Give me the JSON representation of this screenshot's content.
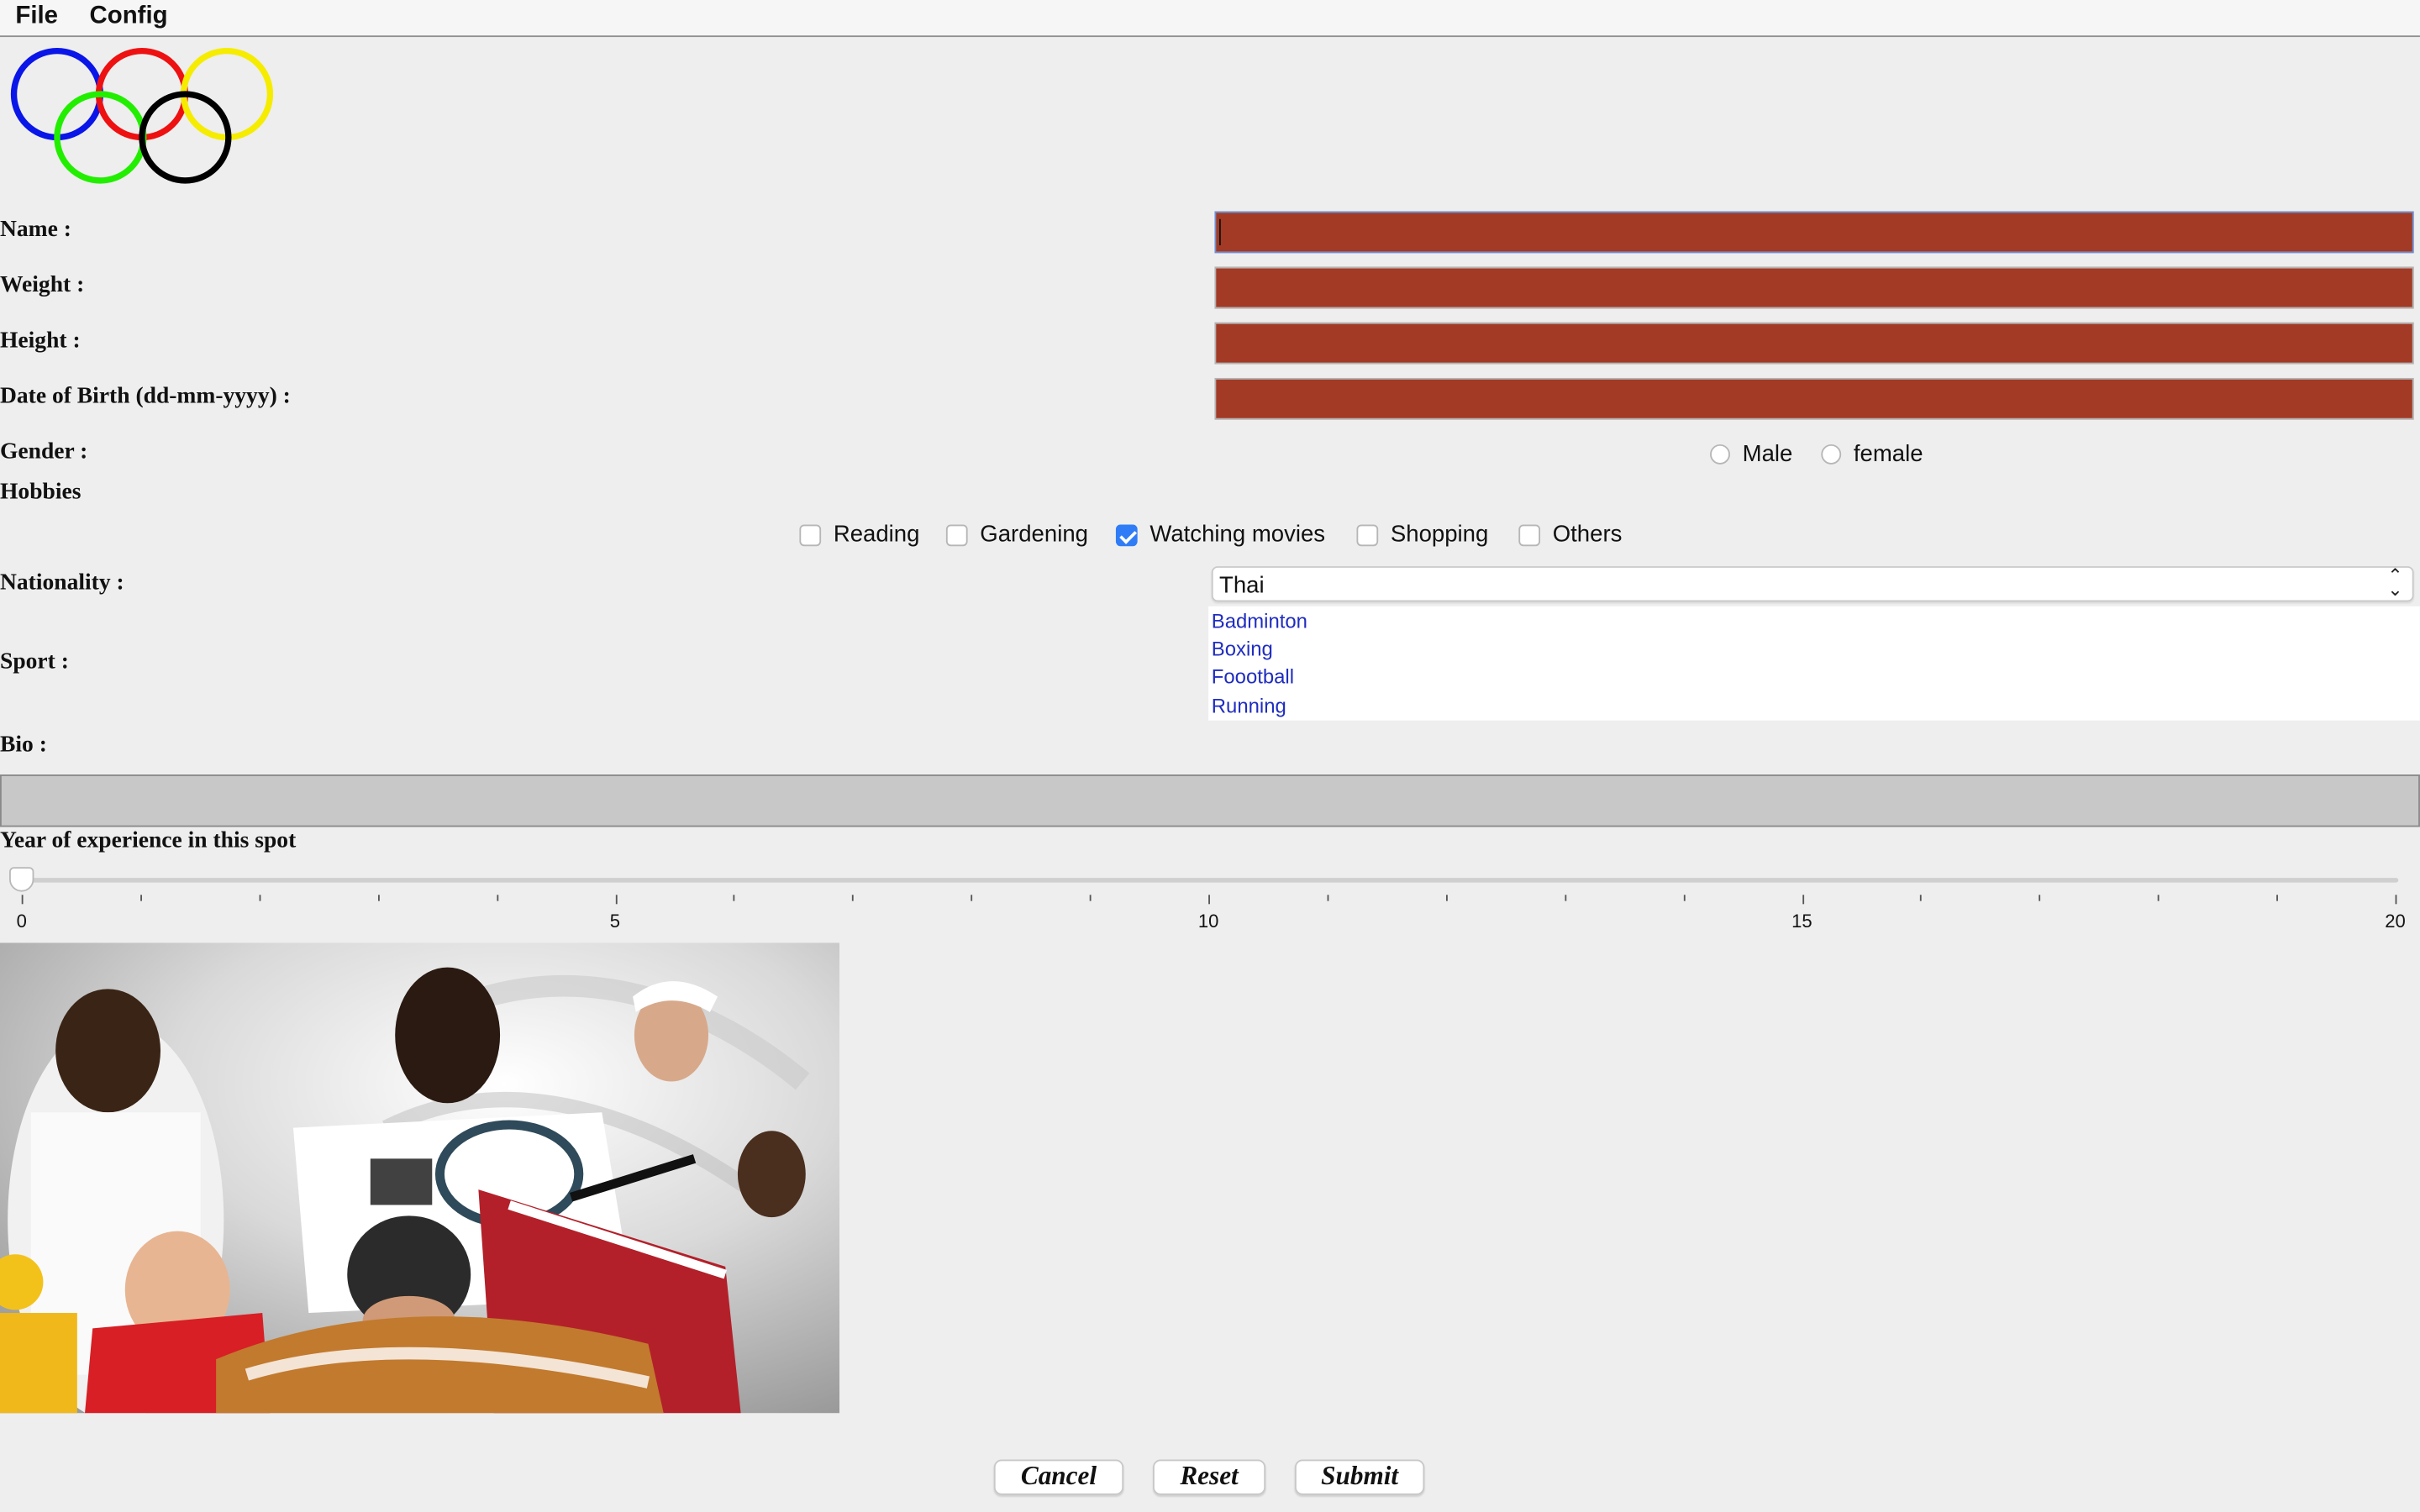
{
  "menu": {
    "file": "File",
    "config": "Config"
  },
  "logo": {
    "ring_colors": [
      "#0a15e8",
      "#ee1111",
      "#f5ec00",
      "#22ee00",
      "#000000"
    ]
  },
  "form": {
    "name_label": "Name :",
    "weight_label": "Weight :",
    "height_label": "Height :",
    "dob_label": "Date of Birth (dd-mm-yyyy) :",
    "gender_label": "Gender :",
    "hobbies_label": "Hobbies",
    "nationality_label": "Nationality :",
    "sport_label": "Sport :",
    "bio_label": "Bio :",
    "experience_label": "Year of experience in this spot",
    "field_color": "#a33a25",
    "name_value": "",
    "weight_value": "",
    "height_value": "",
    "dob_value": ""
  },
  "gender": {
    "options": [
      {
        "label": "Male",
        "selected": false
      },
      {
        "label": "female",
        "selected": false
      }
    ]
  },
  "hobbies": {
    "options": [
      {
        "label": "Reading",
        "checked": false
      },
      {
        "label": "Gardening",
        "checked": false
      },
      {
        "label": "Watching movies",
        "checked": true
      },
      {
        "label": "Shopping",
        "checked": false
      },
      {
        "label": "Others",
        "checked": false
      }
    ]
  },
  "nationality": {
    "selected": "Thai"
  },
  "sports": {
    "items": [
      "Badminton",
      "Boxing",
      "Foootball",
      "Running"
    ]
  },
  "slider": {
    "min": 0,
    "max": 20,
    "value": 0,
    "major_labels": [
      "0",
      "5",
      "10",
      "15",
      "20"
    ]
  },
  "buttons": {
    "cancel": "Cancel",
    "reset": "Reset",
    "submit": "Submit"
  }
}
